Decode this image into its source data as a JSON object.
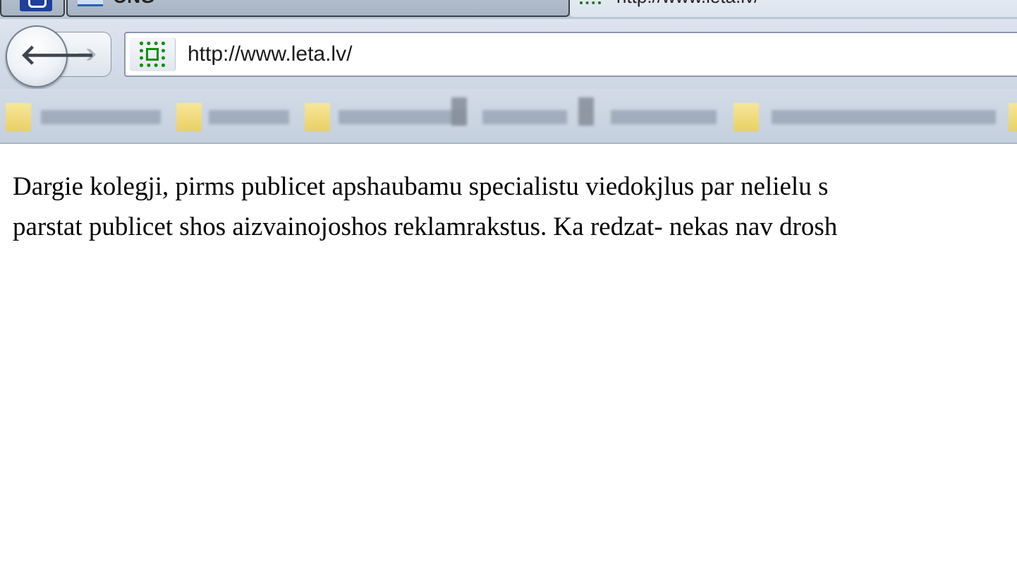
{
  "browser": {
    "tabs": [
      {
        "label": ""
      },
      {
        "label": "ONG"
      },
      {
        "label": "http://www.leta.lv/"
      }
    ],
    "url": "http://www.leta.lv/"
  },
  "page": {
    "lines": [
      "Dargie kolegji, pirms publicet apshaubamu specialistu viedokjlus par nelielu s",
      "parstat publicet shos aizvainojoshos reklamrakstus. Ka redzat- nekas nav drosh"
    ]
  }
}
